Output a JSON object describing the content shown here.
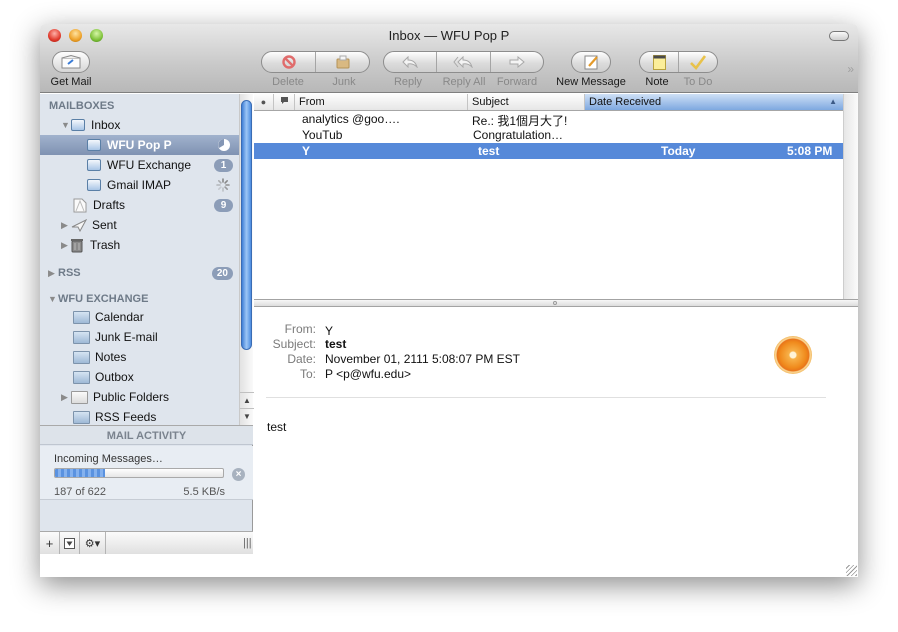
{
  "window": {
    "title": "Inbox — WFU Pop P"
  },
  "toolbar": {
    "get_mail": "Get Mail",
    "delete": "Delete",
    "junk": "Junk",
    "reply": "Reply",
    "reply_all": "Reply All",
    "forward": "Forward",
    "new_message": "New Message",
    "note": "Note",
    "to_do": "To Do",
    "overflow": "»"
  },
  "sidebar": {
    "mailboxes_header": "MAILBOXES",
    "inbox": "Inbox",
    "accounts": [
      {
        "label": "WFU Pop P",
        "status": "syncing-pie",
        "selected": true
      },
      {
        "label": "WFU Exchange",
        "badge": "1"
      },
      {
        "label": "Gmail IMAP",
        "status": "spinner"
      }
    ],
    "drafts": {
      "label": "Drafts",
      "badge": "9"
    },
    "sent": "Sent",
    "trash": "Trash",
    "rss": {
      "label": "RSS",
      "badge": "20"
    },
    "exchange_header": "WFU EXCHANGE",
    "exchange_folders": [
      "Calendar",
      "Junk E-mail",
      "Notes",
      "Outbox",
      "Public Folders",
      "RSS Feeds"
    ]
  },
  "activity": {
    "header": "MAIL ACTIVITY",
    "title": "Incoming Messages…",
    "count": "187 of 622",
    "rate": "5.5 KB/s",
    "progress": 0.3
  },
  "message_list": {
    "columns": {
      "from": "From",
      "subject": "Subject",
      "date": "Date Received"
    },
    "sort_indicator": "▲",
    "rows": [
      {
        "from": "analytics @goo….",
        "subject": "Re.: 我1個月大了!",
        "date": "",
        "time": ""
      },
      {
        "from": "YouTub",
        "subject": "Congratulation…",
        "date": "",
        "time": ""
      },
      {
        "from": "Y",
        "subject": "test",
        "date": "Today",
        "time": "5:08 PM",
        "selected": true
      }
    ]
  },
  "preview": {
    "labels": {
      "from": "From:",
      "subject": "Subject:",
      "date": "Date:",
      "to": "To:"
    },
    "from": "Y",
    "subject": "test",
    "date": "November 01, 2111 5:08:07 PM EST",
    "to": "P <p@wfu.edu>",
    "body": "test"
  },
  "colors": {
    "selection": "#5689d9",
    "sidebar_bg": "#dfe5ed",
    "sidebar_selection": "#8d9fbd",
    "badge": "#8c9db8"
  }
}
